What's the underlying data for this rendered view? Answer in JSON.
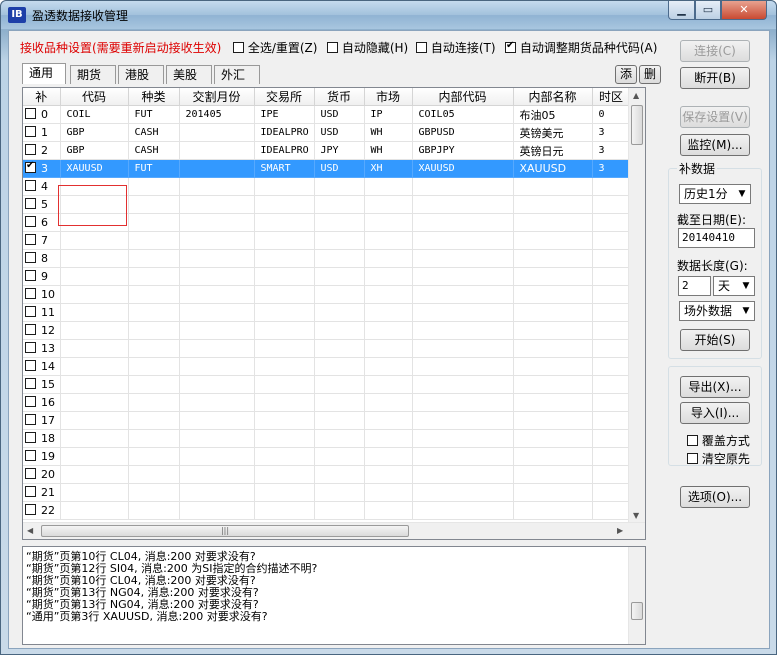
{
  "window": {
    "title": "盈透数据接收管理",
    "icon_text": "IB"
  },
  "top": {
    "label": "接收品种设置(需要重新启动接收生效)",
    "checks": [
      {
        "label": "全选/重置(Z)",
        "checked": false
      },
      {
        "label": "自动隐藏(H)",
        "checked": false
      },
      {
        "label": "自动连接(T)",
        "checked": false
      },
      {
        "label": "自动调整期货品种代码(A)",
        "checked": true
      }
    ]
  },
  "tabs": [
    "通用",
    "期货",
    "港股",
    "美股",
    "外汇"
  ],
  "tab_buttons": {
    "add": "添",
    "delete": "删"
  },
  "table": {
    "columns": [
      "补",
      "代码",
      "种类",
      "交割月份",
      "交易所",
      "货币",
      "市场",
      "内部代码",
      "内部名称",
      "时区"
    ],
    "rows": [
      {
        "checked": false,
        "index": "0",
        "code": "COIL",
        "type": "FUT",
        "expiry": "201405",
        "exchange": "IPE",
        "currency": "USD",
        "market": "IP",
        "inner_code": "COIL05",
        "inner_name": "布油05",
        "tz": "0"
      },
      {
        "checked": false,
        "index": "1",
        "code": "GBP",
        "type": "CASH",
        "expiry": "",
        "exchange": "IDEALPRO",
        "currency": "USD",
        "market": "WH",
        "inner_code": "GBPUSD",
        "inner_name": "英镑美元",
        "tz": "3"
      },
      {
        "checked": false,
        "index": "2",
        "code": "GBP",
        "type": "CASH",
        "expiry": "",
        "exchange": "IDEALPRO",
        "currency": "JPY",
        "market": "WH",
        "inner_code": "GBPJPY",
        "inner_name": "英镑日元",
        "tz": "3"
      },
      {
        "checked": true,
        "index": "3",
        "code": "XAUUSD",
        "type": "FUT",
        "expiry": "",
        "exchange": "SMART",
        "currency": "USD",
        "market": "XH",
        "inner_code": "XAUUSD",
        "inner_name": "XAUUSD",
        "tz": "3",
        "selected": true
      },
      {
        "checked": false,
        "index": "4"
      },
      {
        "checked": false,
        "index": "5"
      },
      {
        "checked": false,
        "index": "6"
      },
      {
        "checked": false,
        "index": "7"
      },
      {
        "checked": false,
        "index": "8"
      },
      {
        "checked": false,
        "index": "9"
      },
      {
        "checked": false,
        "index": "10"
      },
      {
        "checked": false,
        "index": "11"
      },
      {
        "checked": false,
        "index": "12"
      },
      {
        "checked": false,
        "index": "13"
      },
      {
        "checked": false,
        "index": "14"
      },
      {
        "checked": false,
        "index": "15"
      },
      {
        "checked": false,
        "index": "16"
      },
      {
        "checked": false,
        "index": "17"
      },
      {
        "checked": false,
        "index": "18"
      },
      {
        "checked": false,
        "index": "19"
      },
      {
        "checked": false,
        "index": "20"
      },
      {
        "checked": false,
        "index": "21"
      },
      {
        "checked": false,
        "index": "22"
      }
    ]
  },
  "log": [
    "“期货”页第10行 CL04, 消息:200 对要求没有?",
    "“期货”页第12行 SI04, 消息:200 为SI指定的合约描述不明?",
    "“期货”页第10行 CL04, 消息:200 对要求没有?",
    "“期货”页第13行 NG04, 消息:200 对要求没有?",
    "“期货”页第13行 NG04, 消息:200 对要求没有?",
    "“通用”页第3行 XAUUSD, 消息:200 对要求没有?"
  ],
  "side": {
    "connect": "连接(C)",
    "disconnect": "断开(B)",
    "save": "保存设置(V)",
    "monitor": "监控(M)...",
    "fill_title": "补数据",
    "period": "历史1分",
    "end_label": "截至日期(E):",
    "end_value": "20140410",
    "length_label": "数据长度(G):",
    "length_value": "2",
    "length_unit": "天",
    "source": "场外数据",
    "start": "开始(S)",
    "export": "导出(X)...",
    "import": "导入(I)...",
    "overwrite": "覆盖方式",
    "clear_first": "清空原先",
    "options": "选项(O)..."
  }
}
